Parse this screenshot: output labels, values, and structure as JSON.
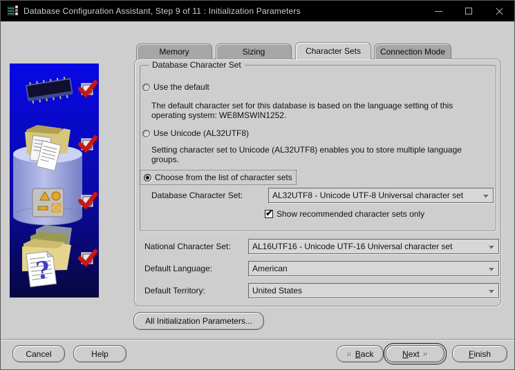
{
  "titlebar": {
    "title": "Database Configuration Assistant, Step 9 of 11 : Initialization Parameters"
  },
  "tabs": [
    {
      "label": "Memory",
      "active": false
    },
    {
      "label": "Sizing",
      "active": false
    },
    {
      "label": "Character Sets",
      "active": true
    },
    {
      "label": "Connection Mode",
      "active": false
    }
  ],
  "character_set_group": {
    "title": "Database Character Set",
    "use_default": {
      "label": "Use the default",
      "selected": false,
      "description": "The default character set for this database is based on the language setting of this operating system: WE8MSWIN1252."
    },
    "use_unicode": {
      "label": "Use Unicode (AL32UTF8)",
      "selected": false,
      "description": "Setting character set to Unicode (AL32UTF8) enables you to store multiple language groups."
    },
    "choose_from_list": {
      "label": "Choose from the list of character sets",
      "selected": true
    },
    "database_character_set": {
      "label": "Database Character Set:",
      "value": "AL32UTF8 - Unicode UTF-8 Universal character set"
    },
    "show_recommended": {
      "label": "Show recommended character sets only",
      "checked": true,
      "check_glyph": "✔"
    }
  },
  "fields": {
    "national_character_set": {
      "label": "National Character Set:",
      "value": "AL16UTF16 - Unicode UTF-16 Universal character set"
    },
    "default_language": {
      "label": "Default Language:",
      "value": "American"
    },
    "default_territory": {
      "label": "Default Territory:",
      "value": "United States"
    }
  },
  "buttons": {
    "all_init_params": "All Initialization Parameters...",
    "cancel": "Cancel",
    "help": "Help",
    "back": {
      "mnemonic": "B",
      "rest": "ack",
      "chevron": "«"
    },
    "next": {
      "mnemonic": "N",
      "rest": "ext",
      "chevron": "»"
    },
    "finish": {
      "mnemonic": "F",
      "rest": "inish"
    }
  },
  "wizard_art": {
    "icons": [
      "memory-chip",
      "folder-documents",
      "database-cylinder",
      "shapes-tile",
      "folder-stack",
      "question-document"
    ],
    "completed_steps": 4
  },
  "colors": {
    "titlebar": "#000000",
    "dialog_bg": "#cecece",
    "art_blue_top": "#0808e6",
    "art_blue_bottom": "#070740",
    "check_red": "#c41414",
    "tab_inactive": "#a6a6a6"
  }
}
